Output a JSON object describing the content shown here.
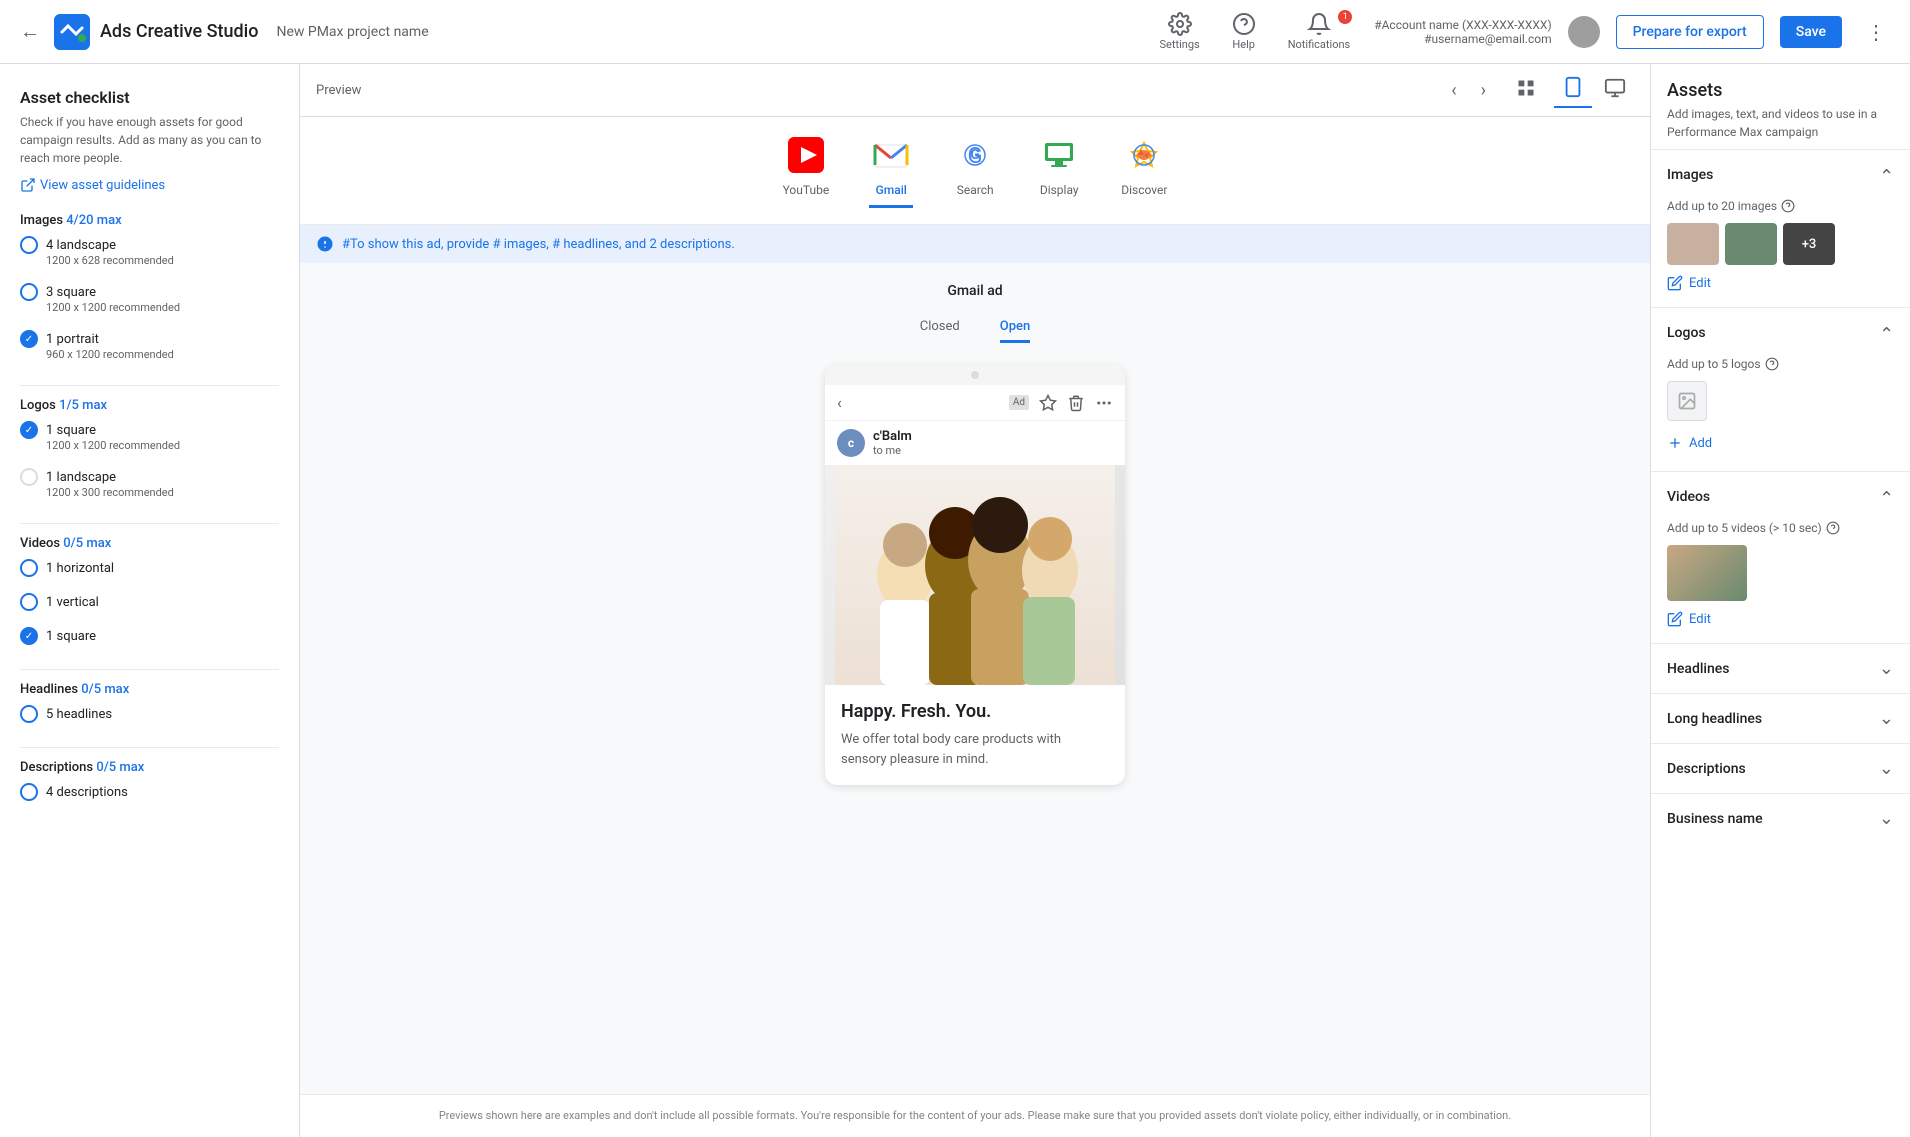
{
  "header": {
    "back_label": "←",
    "app_title": "Ads Creative Studio",
    "project_name": "New PMax project name",
    "settings_label": "Settings",
    "help_label": "Help",
    "notifications_label": "Notifications",
    "notification_count": "1",
    "account_name": "#Account name (XXX-XXX-XXXX)",
    "username": "#username@email.com",
    "prepare_btn": "Prepare for export",
    "save_btn": "Save",
    "more_icon": "⋮"
  },
  "left_sidebar": {
    "title": "Asset checklist",
    "description": "Check if you have enough assets for good campaign results. Add as many as you can to reach more people.",
    "guidelines_link": "View asset guidelines",
    "sections": [
      {
        "title": "Images",
        "count": "4/20 max",
        "items": [
          {
            "label": "4 landscape",
            "sub": "1200 x 628 recommended",
            "status": "outline-blue"
          },
          {
            "label": "3 square",
            "sub": "1200 x 1200 recommended",
            "status": "outline-blue"
          },
          {
            "label": "1 portrait",
            "sub": "960 x 1200 recommended",
            "status": "blue"
          }
        ]
      },
      {
        "title": "Logos",
        "count": "1/5 max",
        "items": [
          {
            "label": "1 square",
            "sub": "1200 x 1200 recommended",
            "status": "blue"
          },
          {
            "label": "1 landscape",
            "sub": "1200 x 300 recommended",
            "status": "outline"
          }
        ]
      },
      {
        "title": "Videos",
        "count": "0/5 max",
        "items": [
          {
            "label": "1 horizontal",
            "sub": "",
            "status": "outline"
          },
          {
            "label": "1 vertical",
            "sub": "",
            "status": "outline"
          },
          {
            "label": "1 square",
            "sub": "",
            "status": "blue"
          }
        ]
      },
      {
        "title": "Headlines",
        "count": "0/5 max",
        "items": [
          {
            "label": "5 headlines",
            "sub": "",
            "status": "outline"
          }
        ]
      },
      {
        "title": "Descriptions",
        "count": "0/5 max",
        "items": [
          {
            "label": "4 descriptions",
            "sub": "",
            "status": "outline"
          }
        ]
      }
    ]
  },
  "preview": {
    "label": "Preview",
    "channels": [
      {
        "id": "youtube",
        "label": "YouTube",
        "active": false
      },
      {
        "id": "gmail",
        "label": "Gmail",
        "active": true
      },
      {
        "id": "search",
        "label": "Search",
        "active": false
      },
      {
        "id": "display",
        "label": "Display",
        "active": false
      },
      {
        "id": "discover",
        "label": "Discover",
        "active": false
      }
    ],
    "info_text": "#To show this ad, provide # images, # headlines, and 2 descriptions.",
    "ad": {
      "title": "Gmail ad",
      "tab_closed": "Closed",
      "tab_open": "Open",
      "sender_name": "c'Balm",
      "sender_sub": "to me",
      "headline": "Happy. Fresh. You.",
      "body_text": "We offer total body care products with sensory pleasure in mind."
    },
    "footer_text": "Previews shown here are examples and don't include all possible formats. You're responsible for the content of your ads.\nPlease make sure that you provided assets don't violate policy, either individually, or in combination."
  },
  "right_sidebar": {
    "title": "Assets",
    "description": "Add images, text, and videos to use in a Performance Max campaign",
    "sections": [
      {
        "id": "images",
        "title": "Images",
        "subtitle": "Add up to 20 images",
        "expanded": true,
        "has_edit": true,
        "edit_label": "Edit",
        "plus_count": "+ 3"
      },
      {
        "id": "logos",
        "title": "Logos",
        "subtitle": "Add up to 5 logos",
        "expanded": true,
        "has_add": true,
        "add_label": "Add"
      },
      {
        "id": "videos",
        "title": "Videos",
        "subtitle": "Add up to 5 videos (> 10 sec)",
        "expanded": true,
        "has_edit": true,
        "edit_label": "Edit"
      },
      {
        "id": "headlines",
        "title": "Headlines",
        "expanded": false
      },
      {
        "id": "long-headlines",
        "title": "Long headlines",
        "expanded": false
      },
      {
        "id": "descriptions",
        "title": "Descriptions",
        "expanded": false
      },
      {
        "id": "business-name",
        "title": "Business name",
        "expanded": false
      }
    ]
  }
}
